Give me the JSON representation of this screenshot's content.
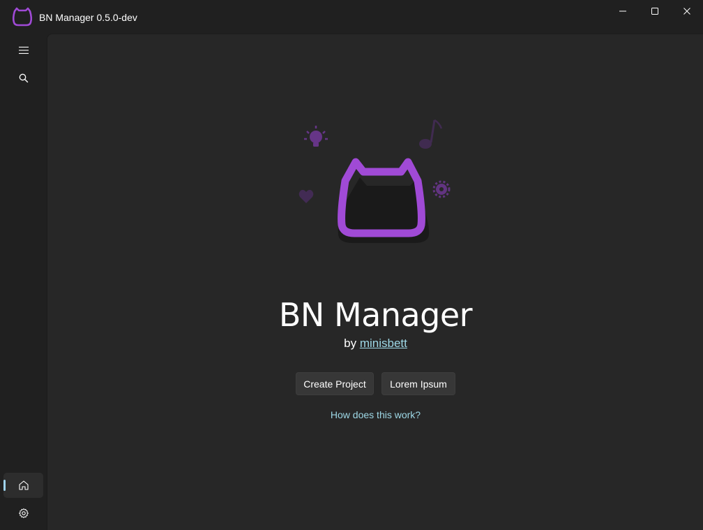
{
  "window": {
    "title": "BN Manager 0.5.0-dev",
    "accent": "#a04ad6"
  },
  "sidebar": {
    "items": [
      {
        "name": "menu",
        "icon": "hamburger-menu-icon"
      },
      {
        "name": "search",
        "icon": "search-icon"
      },
      {
        "name": "home",
        "icon": "home-icon",
        "selected": true
      },
      {
        "name": "settings",
        "icon": "gear-icon"
      }
    ]
  },
  "main": {
    "title": "BN Manager",
    "by_prefix": "by",
    "author": "minisbett",
    "buttons": {
      "create_project": "Create Project",
      "lorem_ipsum": "Lorem Ipsum"
    },
    "help_link": "How does this work?"
  },
  "colors": {
    "link": "#9ed8e6",
    "indicator": "#9fd3ee",
    "logo": "#a04ad6",
    "background": "#202020",
    "content": "#272727"
  }
}
